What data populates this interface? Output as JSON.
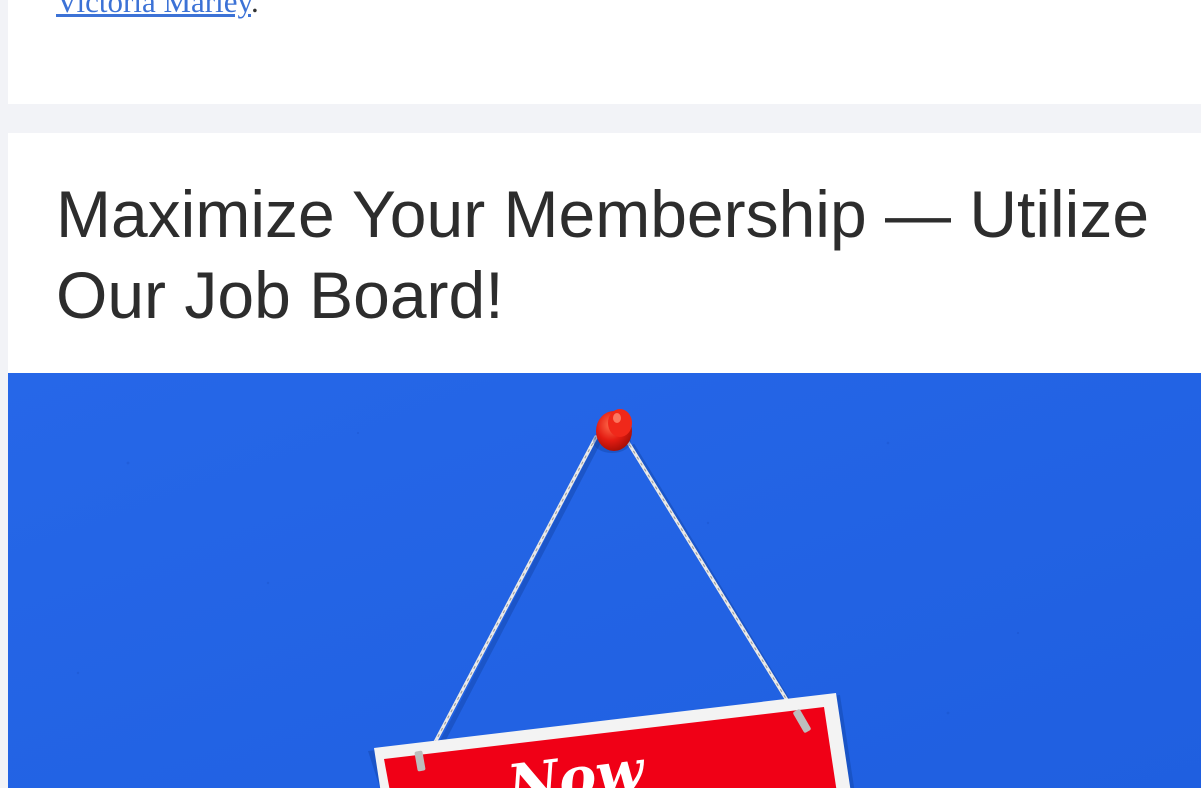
{
  "previous_section": {
    "link_text": "Victoria Marley",
    "trailing_punctuation": "."
  },
  "feature": {
    "title": "Maximize Your Membership — Utilize Our Job Board!",
    "image": {
      "description_icon": "hanging-sign-image",
      "sign_text": "Now",
      "background_color": "#2263e6",
      "sign_color": "#f00016",
      "pin_color": "#e31c12"
    }
  }
}
